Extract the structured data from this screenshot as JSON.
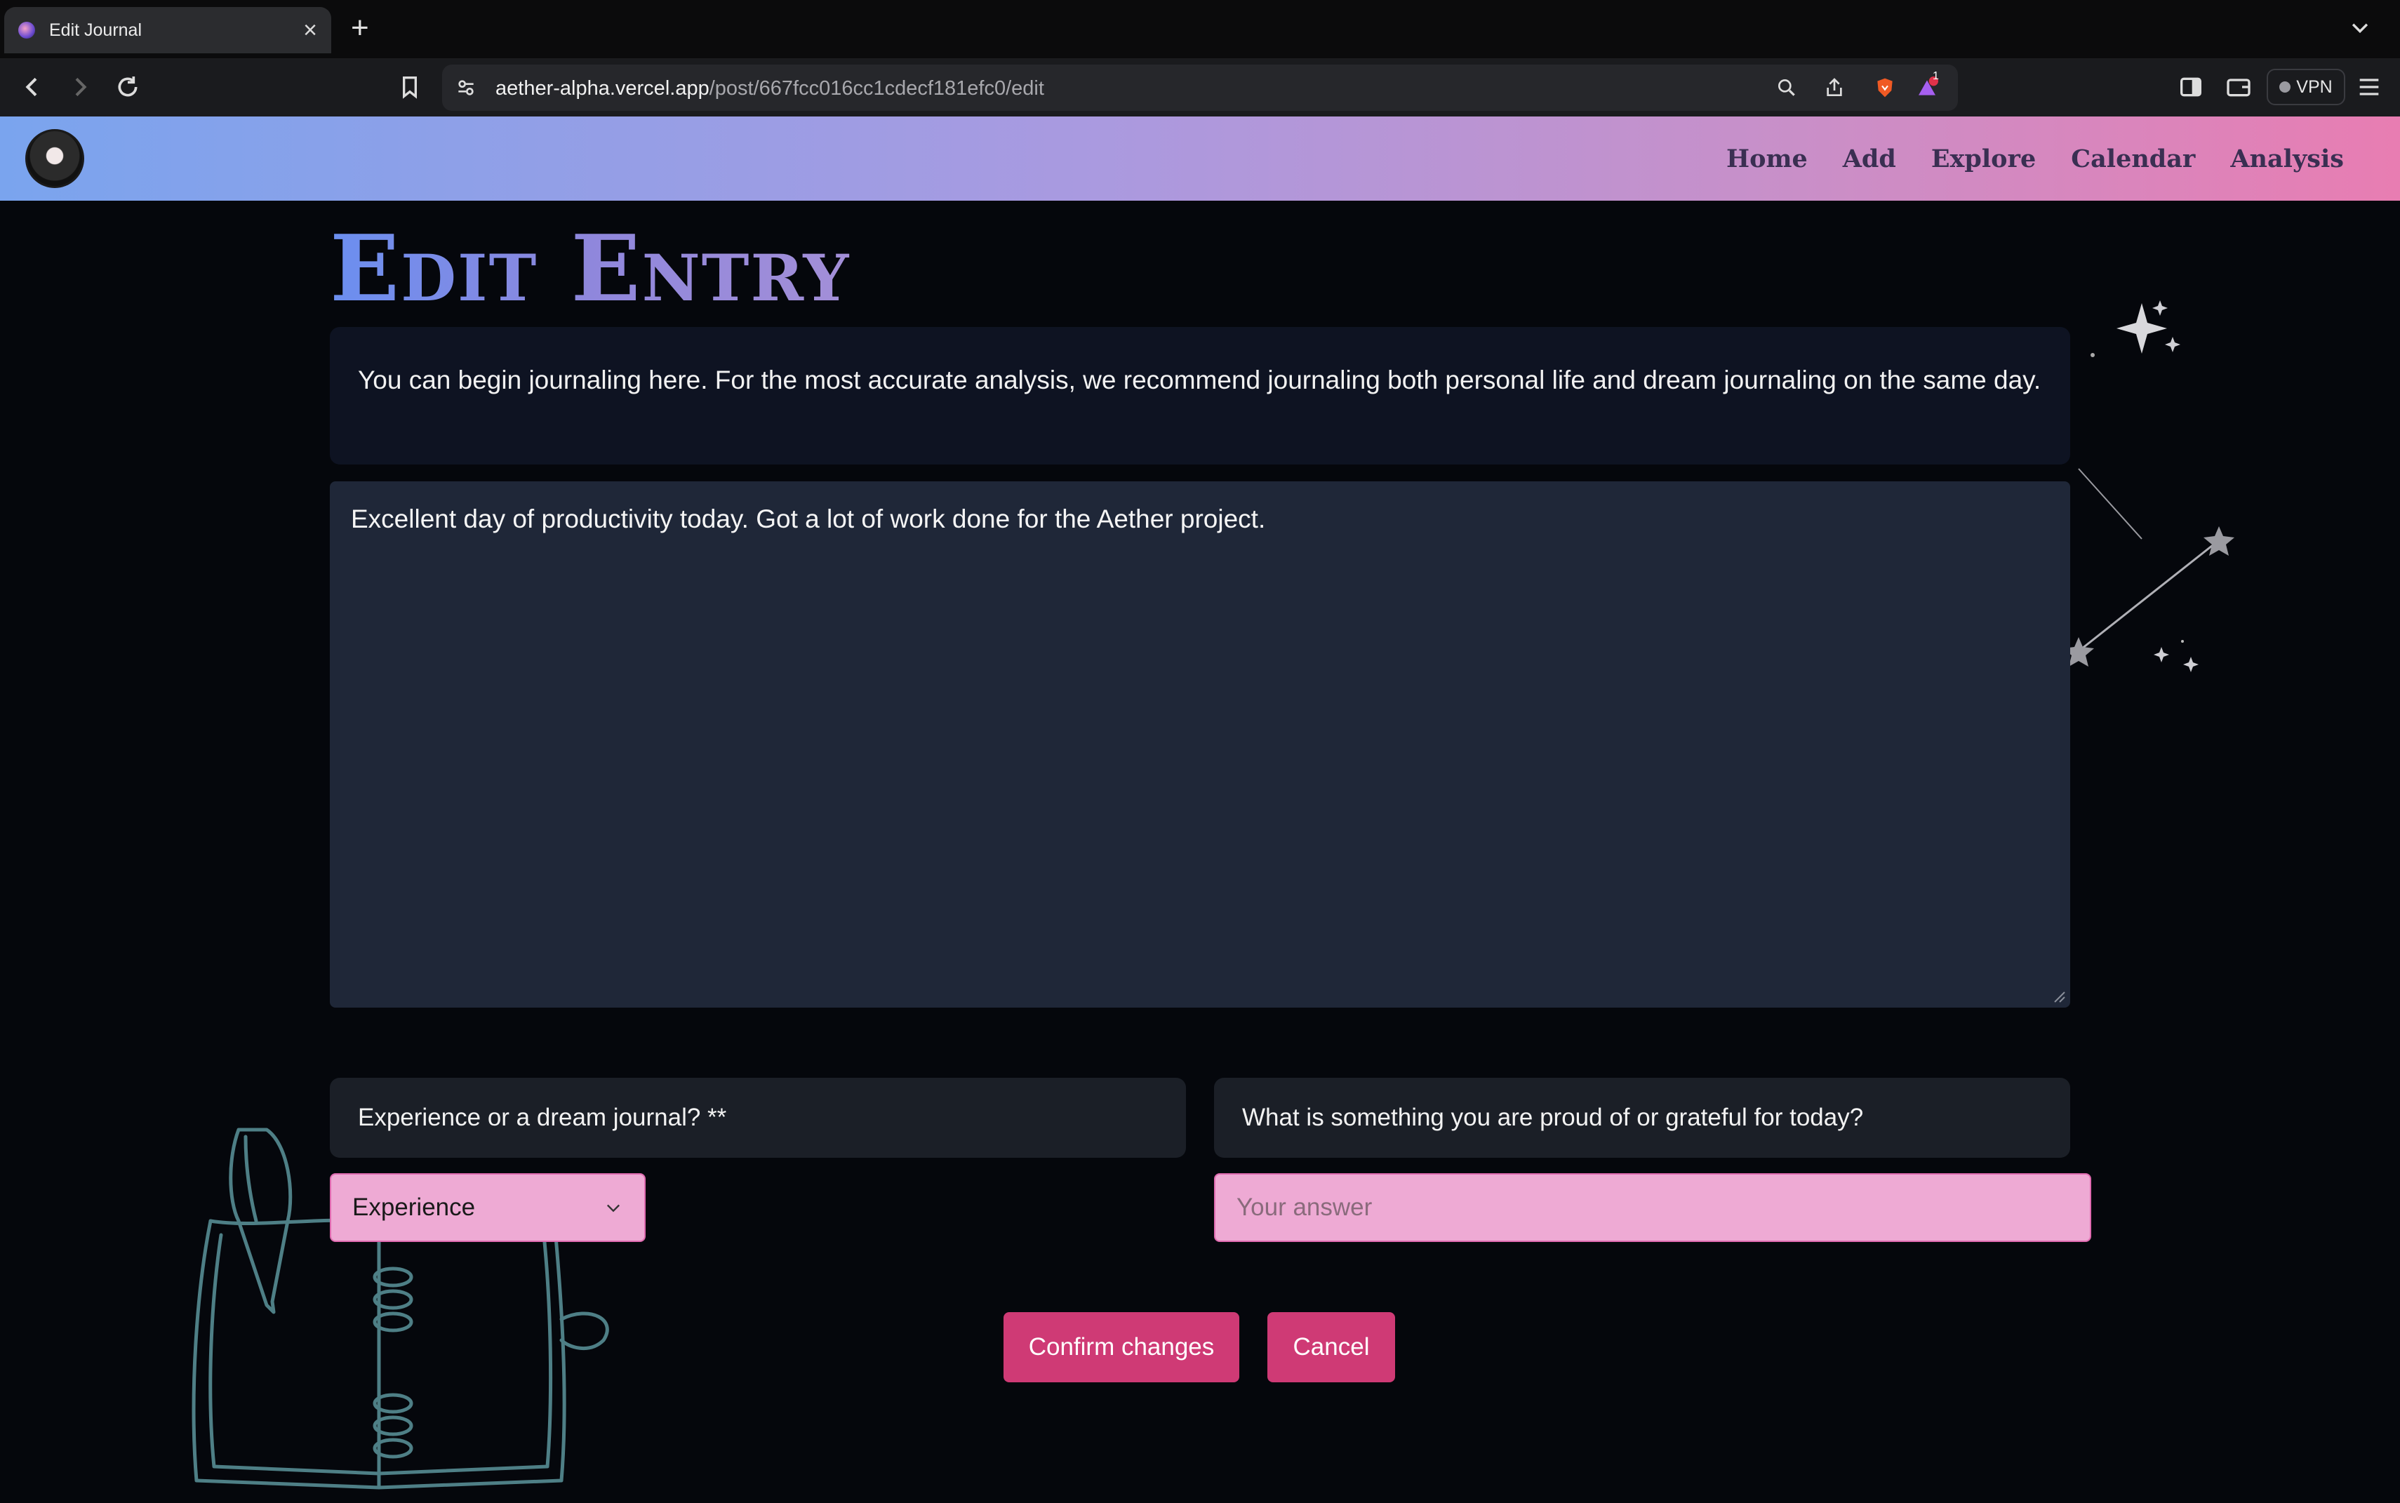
{
  "browser": {
    "tab_title": "Edit Journal",
    "url_host": "aether-alpha.vercel.app",
    "url_path": "/post/667fcc016cc1cdecf181efc0/edit",
    "vpn_label": "VPN",
    "notification_count": "1"
  },
  "nav": {
    "items": [
      {
        "label": "Home"
      },
      {
        "label": "Add"
      },
      {
        "label": "Explore"
      },
      {
        "label": "Calendar"
      },
      {
        "label": "Analysis"
      }
    ]
  },
  "page": {
    "title": "Edit Entry",
    "intro": "You can begin journaling here. For the most accurate analysis, we recommend journaling both personal life and dream journaling on the same day.",
    "journal_text": "Excellent day of productivity today. Got a lot of work done for the Aether project."
  },
  "form": {
    "type_question": "Experience or a dream journal? **",
    "type_selected": "Experience",
    "gratitude_question": "What is something you are proud of or grateful for today?",
    "gratitude_placeholder": "Your answer"
  },
  "actions": {
    "confirm_label": "Confirm changes",
    "cancel_label": "Cancel"
  },
  "colors": {
    "accent": "#cf3a75",
    "input_bg": "#eeaad4",
    "header_gradient_start": "#7aa4ee",
    "header_gradient_end": "#e87db2"
  }
}
